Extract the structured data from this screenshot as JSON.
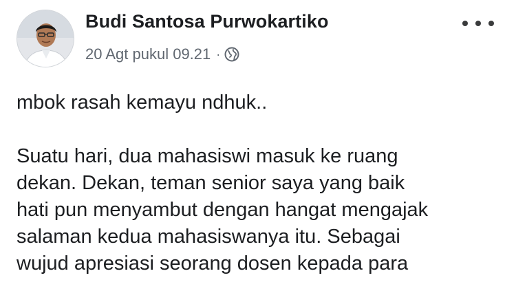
{
  "post": {
    "author": {
      "name": "Budi Santosa Purwokartiko",
      "avatar": "profile-photo"
    },
    "meta": {
      "timestamp": "20 Agt pukul 09.21",
      "separator": "·",
      "privacy_icon": "globe-icon"
    },
    "more_icon": "more-options-icon",
    "text": {
      "intro": "mbok rasah kemayu ndhuk..",
      "lines": [
        "Suatu hari, dua mahasiswi masuk ke ruang",
        "dekan. Dekan, teman senior saya yang baik",
        "hati pun menyambut dengan hangat mengajak",
        "salaman kedua mahasiswanya itu. Sebagai",
        "wujud apresiasi seorang dosen kepada para"
      ]
    }
  }
}
